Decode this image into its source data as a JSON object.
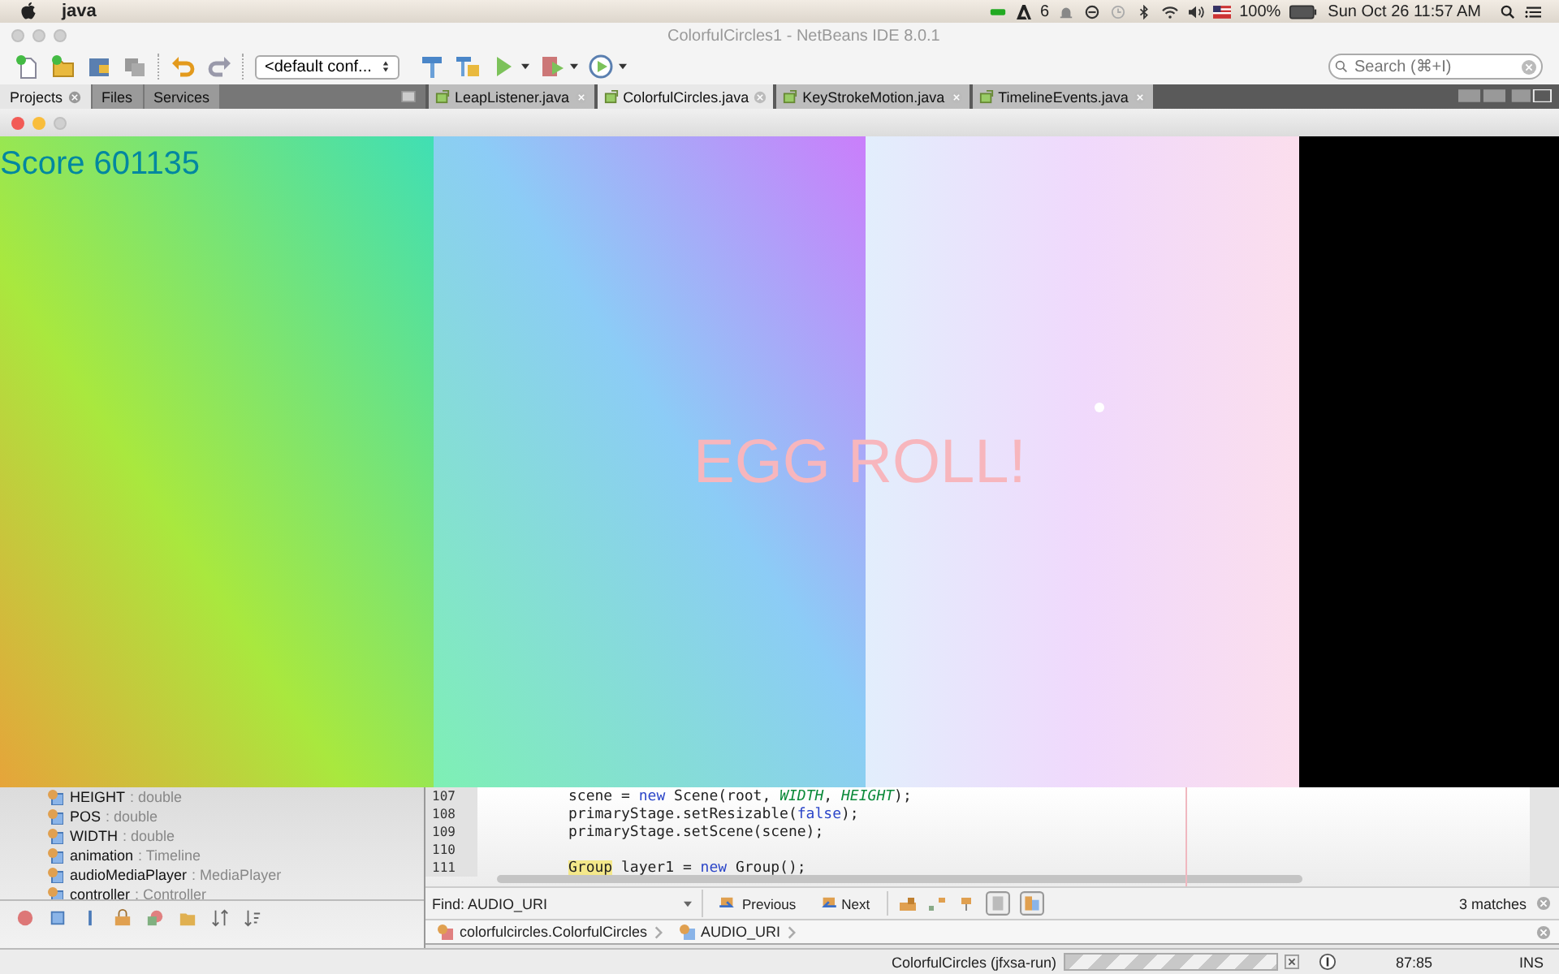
{
  "menu_bar": {
    "app_name": "java",
    "adobe_count": "6",
    "battery": "100%",
    "clock": "Sun Oct 26  11:57 AM"
  },
  "ide_window": {
    "title": "ColorfulCircles1 - NetBeans IDE 8.0.1",
    "config_dropdown": "<default conf...",
    "search": {
      "placeholder": "Search (⌘+I)"
    }
  },
  "panel_tabs": [
    {
      "label": "Projects",
      "selected": true
    },
    {
      "label": "Files",
      "selected": false
    },
    {
      "label": "Services",
      "selected": false
    }
  ],
  "editor_tabs": [
    {
      "label": "LeapListener.java",
      "selected": false
    },
    {
      "label": "ColorfulCircles.java",
      "selected": true
    },
    {
      "label": "KeyStrokeMotion.java",
      "selected": false
    },
    {
      "label": "TimelineEvents.java",
      "selected": false
    }
  ],
  "game_window": {
    "score": "Score 601135",
    "message": "EGG ROLL!"
  },
  "navigator": [
    {
      "name": "HEIGHT",
      "type": ": double"
    },
    {
      "name": "POS",
      "type": ": double"
    },
    {
      "name": "WIDTH",
      "type": ": double"
    },
    {
      "name": "animation",
      "type": ": Timeline"
    },
    {
      "name": "audioMediaPlayer",
      "type": ": MediaPlayer"
    },
    {
      "name": "controller",
      "type": ": Controller"
    }
  ],
  "code_lines": [
    {
      "number": "107",
      "tokens": [
        {
          "kind": "plain",
          "text": "scene = "
        },
        {
          "kind": "keyword",
          "text": "new"
        },
        {
          "kind": "plain",
          "text": " Scene(root, "
        },
        {
          "kind": "constant",
          "text": "WIDTH"
        },
        {
          "kind": "plain",
          "text": ", "
        },
        {
          "kind": "constant",
          "text": "HEIGHT"
        },
        {
          "kind": "plain",
          "text": ");"
        }
      ]
    },
    {
      "number": "108",
      "tokens": [
        {
          "kind": "plain",
          "text": "primaryStage.setResizable("
        },
        {
          "kind": "keyword",
          "text": "false"
        },
        {
          "kind": "plain",
          "text": ");"
        }
      ]
    },
    {
      "number": "109",
      "tokens": [
        {
          "kind": "plain",
          "text": "primaryStage.setScene(scene);"
        }
      ]
    },
    {
      "number": "110"
    },
    {
      "number": "111",
      "tokens": [
        {
          "kind": "highlight",
          "text": "Group"
        },
        {
          "kind": "plain",
          "text": " layer1 = "
        },
        {
          "kind": "keyword",
          "text": "new"
        },
        {
          "kind": "plain",
          "text": " Group();"
        }
      ]
    }
  ],
  "find_bar": {
    "label": "Find: AUDIO_URI",
    "previous": "Previous",
    "next": "Next",
    "matches": "3 matches"
  },
  "breadcrumb": [
    "colorfulcircles.ColorfulCircles",
    "AUDIO_URI"
  ],
  "status_bar": {
    "task": "ColorfulCircles (jfxsa-run)",
    "indeterminate": true,
    "position": "87:85",
    "mode": "INS"
  }
}
